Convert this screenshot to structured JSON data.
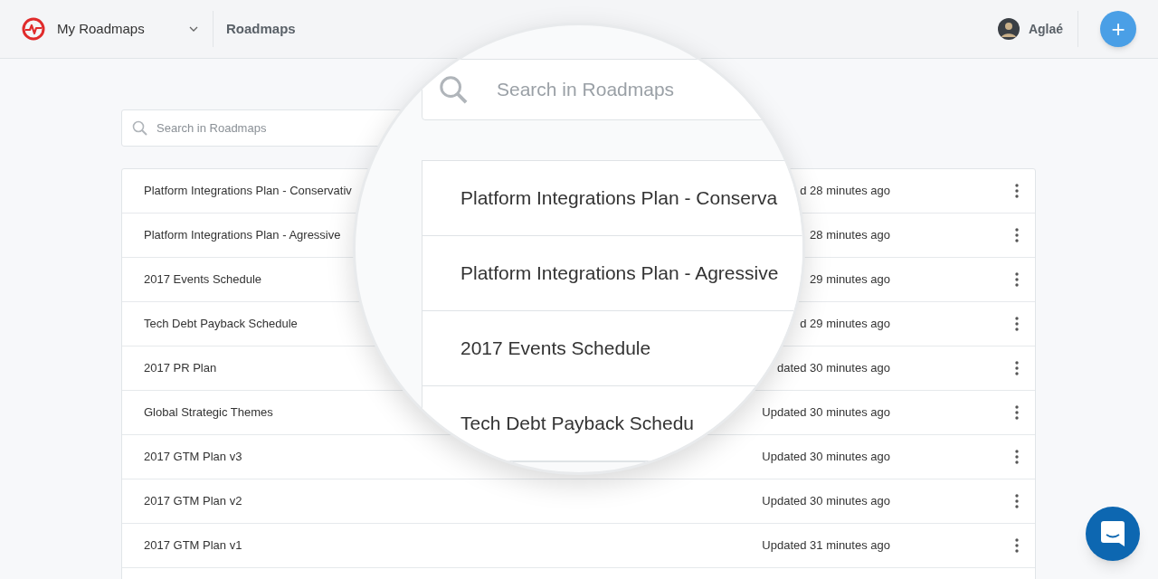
{
  "header": {
    "workspace": "My Roadmaps",
    "breadcrumb": "Roadmaps",
    "user": "Aglaé",
    "add_button": "+"
  },
  "search": {
    "placeholder": "Search in Roadmaps"
  },
  "roadmaps": [
    {
      "name": "Platform Integrations Plan - Conservativ",
      "updated": "d 28 minutes ago"
    },
    {
      "name": "Platform Integrations Plan - Agressive",
      "updated": "28 minutes ago"
    },
    {
      "name": "2017 Events Schedule",
      "updated": "29 minutes ago"
    },
    {
      "name": "Tech Debt Payback Schedule",
      "updated": "d 29 minutes ago"
    },
    {
      "name": "2017 PR Plan",
      "updated": "dated 30 minutes ago"
    },
    {
      "name": "Global Strategic Themes",
      "updated": "Updated 30 minutes ago"
    },
    {
      "name": "2017 GTM Plan v3",
      "updated": "Updated 30 minutes ago"
    },
    {
      "name": "2017 GTM Plan v2",
      "updated": "Updated 30 minutes ago"
    },
    {
      "name": "2017 GTM Plan v1",
      "updated": "Updated 31 minutes ago"
    }
  ],
  "magnifier": {
    "search_placeholder": "Search in Roadmaps",
    "rows": [
      "Platform Integrations Plan - Conserva",
      "Platform Integrations Plan - Agressive",
      "2017 Events Schedule",
      "Tech Debt Payback Schedu"
    ]
  }
}
